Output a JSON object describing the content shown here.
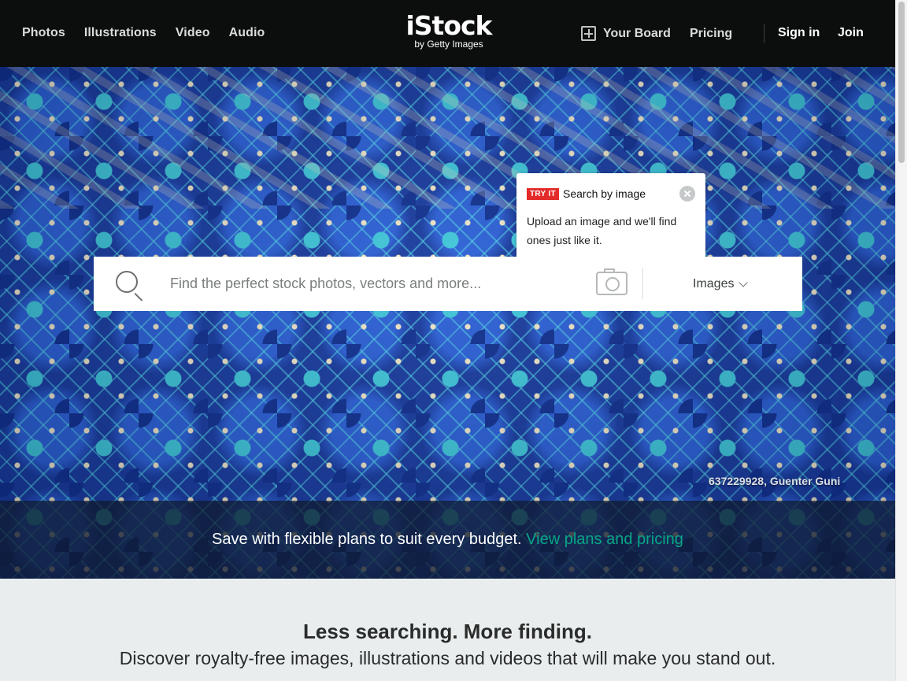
{
  "nav": {
    "items": [
      "Photos",
      "Illustrations",
      "Video",
      "Audio"
    ],
    "logo": {
      "main": "iStock",
      "sub": "by Getty Images"
    },
    "board": "Your Board",
    "pricing": "Pricing",
    "signin": "Sign in",
    "join": "Join"
  },
  "search": {
    "placeholder": "Find the perfect stock photos, vectors and more...",
    "type": "Images"
  },
  "popover": {
    "badge": "TRY IT",
    "title": "Search by image",
    "body": "Upload an image and we'll find ones just like it."
  },
  "hero": {
    "credit": "637229928, Guenter Guni"
  },
  "promo": {
    "text": "Save with flexible plans to suit every budget.",
    "link": "View plans and pricing"
  },
  "tagline": "Less searching. More finding.",
  "subtagline": "Discover royalty-free images, illustrations and videos that will make you stand out."
}
